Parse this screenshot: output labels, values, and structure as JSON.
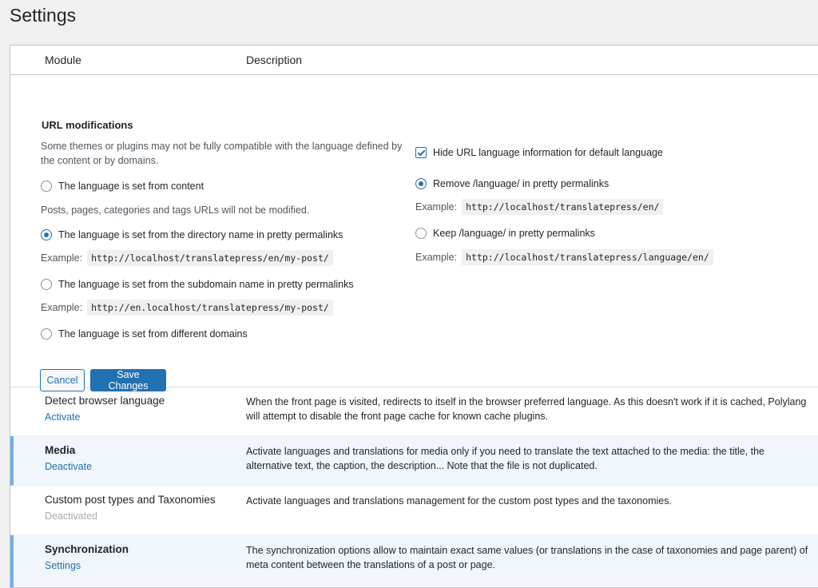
{
  "page": {
    "title": "Settings"
  },
  "table": {
    "col_module": "Module",
    "col_description": "Description"
  },
  "url_modifications": {
    "title": "URL modifications",
    "warning": "Some themes or plugins may not be fully compatible with the language defined by the content or by domains.",
    "opt_content": "The language is set from content",
    "opt_content_note": "Posts, pages, categories and tags URLs will not be modified.",
    "opt_directory": "The language is set from the directory name in pretty permalinks",
    "opt_directory_example_label": "Example:",
    "opt_directory_example": "http://localhost/translatepress/en/my-post/",
    "opt_subdomain": "The language is set from the subdomain name in pretty permalinks",
    "opt_subdomain_example_label": "Example:",
    "opt_subdomain_example": "http://en.localhost/translatepress/my-post/",
    "opt_domains": "The language is set from different domains",
    "selected_option": "opt_directory",
    "hide_default": "Hide URL language information for default language",
    "hide_default_checked": true,
    "remove_slug": "Remove /language/ in pretty permalinks",
    "remove_slug_example_label": "Example:",
    "remove_slug_example": "http://localhost/translatepress/en/",
    "keep_slug": "Keep /language/ in pretty permalinks",
    "keep_slug_example_label": "Example:",
    "keep_slug_example": "http://localhost/translatepress/language/en/",
    "selected_slug_option": "remove_slug",
    "cancel_label": "Cancel",
    "save_label": "Save Changes"
  },
  "modules": [
    {
      "name": "Detect browser language",
      "action": "Activate",
      "description": "When the front page is visited, redirects to itself in the browser preferred language. As this doesn't work if it is cached, Polylang will attempt to disable the front page cache for known cache plugins."
    },
    {
      "name": "Media",
      "action": "Deactivate",
      "description": "Activate languages and translations for media only if you need to translate the text attached to the media: the title, the alternative text, the caption, the description... Note that the file is not duplicated."
    },
    {
      "name": "Custom post types and Taxonomies",
      "action": "Deactivated",
      "description": "Activate languages and translations management for the custom post types and the taxonomies."
    },
    {
      "name": "Synchronization",
      "action": "Settings",
      "description": "The synchronization options allow to maintain exact same values (or translations in the case of taxonomies and page parent) of meta content between the translations of a post or page."
    }
  ],
  "colors": {
    "accent": "#2271b1",
    "active_row_bg": "#f0f6fc",
    "active_row_border": "#72aee6"
  }
}
